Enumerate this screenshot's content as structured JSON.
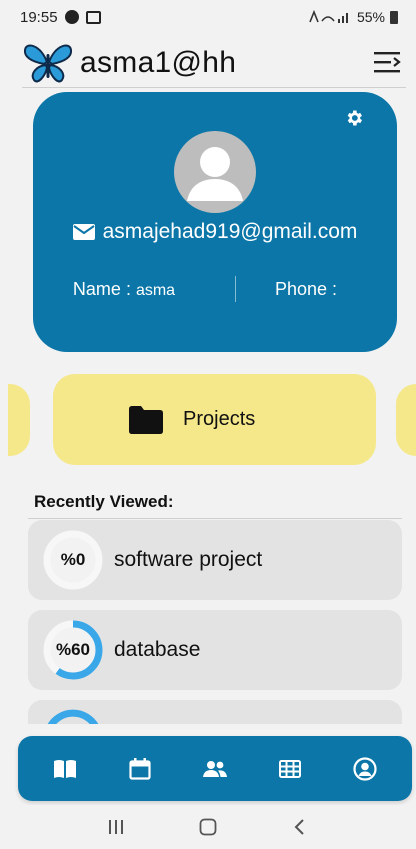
{
  "status_bar": {
    "time": "19:55",
    "battery": "55%"
  },
  "header": {
    "title": "asma1@hh"
  },
  "profile": {
    "email": "asmajehad919@gmail.com",
    "name_label": "Name : ",
    "name_value": "asma",
    "phone_label": "Phone :",
    "phone_value": ""
  },
  "projects_card": {
    "label": "Projects"
  },
  "recent": {
    "title": "Recently Viewed:",
    "items": [
      {
        "percent_text": "%0",
        "progress": 0,
        "label": "software project"
      },
      {
        "percent_text": "%60",
        "progress": 0.6,
        "label": "database"
      }
    ]
  },
  "colors": {
    "primary": "#0b76a7",
    "accent_yellow": "#f5e88a",
    "ring_progress": "#3aa7e8"
  },
  "bottom_nav": {
    "icons": [
      "book-icon",
      "calendar-icon",
      "group-icon",
      "table-icon",
      "profile-icon"
    ]
  }
}
